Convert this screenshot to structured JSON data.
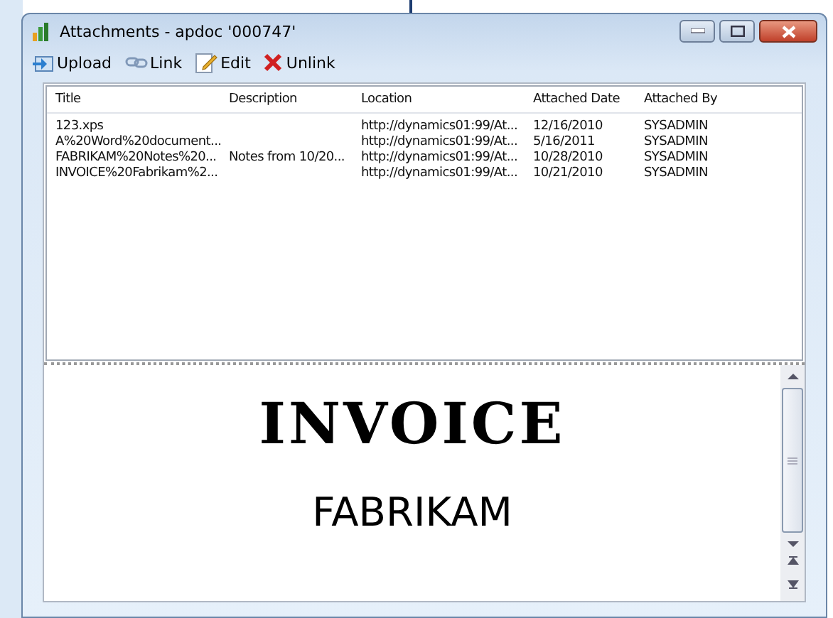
{
  "window": {
    "title": "Attachments - apdoc  '000747'"
  },
  "toolbar": [
    {
      "kind": "upload",
      "label": "Upload"
    },
    {
      "kind": "link",
      "label": "Link"
    },
    {
      "kind": "edit",
      "label": "Edit"
    },
    {
      "kind": "unlink",
      "label": "Unlink"
    }
  ],
  "table": {
    "columns": [
      "Title",
      "Description",
      "Location",
      "Attached Date",
      "Attached By"
    ],
    "rows": [
      [
        "123.xps",
        "",
        "http://dynamics01:99/At...",
        "12/16/2010",
        "SYSADMIN"
      ],
      [
        "A%20Word%20document...",
        "",
        "http://dynamics01:99/At...",
        "5/16/2011",
        "SYSADMIN"
      ],
      [
        "FABRIKAM%20Notes%20...",
        "Notes from 10/20...",
        "http://dynamics01:99/At...",
        "10/28/2010",
        "SYSADMIN"
      ],
      [
        "INVOICE%20Fabrikam%2...",
        "",
        "http://dynamics01:99/At...",
        "10/21/2010",
        "SYSADMIN"
      ]
    ]
  },
  "preview": {
    "heading": "INVOICE",
    "company": "FABRIKAM"
  }
}
